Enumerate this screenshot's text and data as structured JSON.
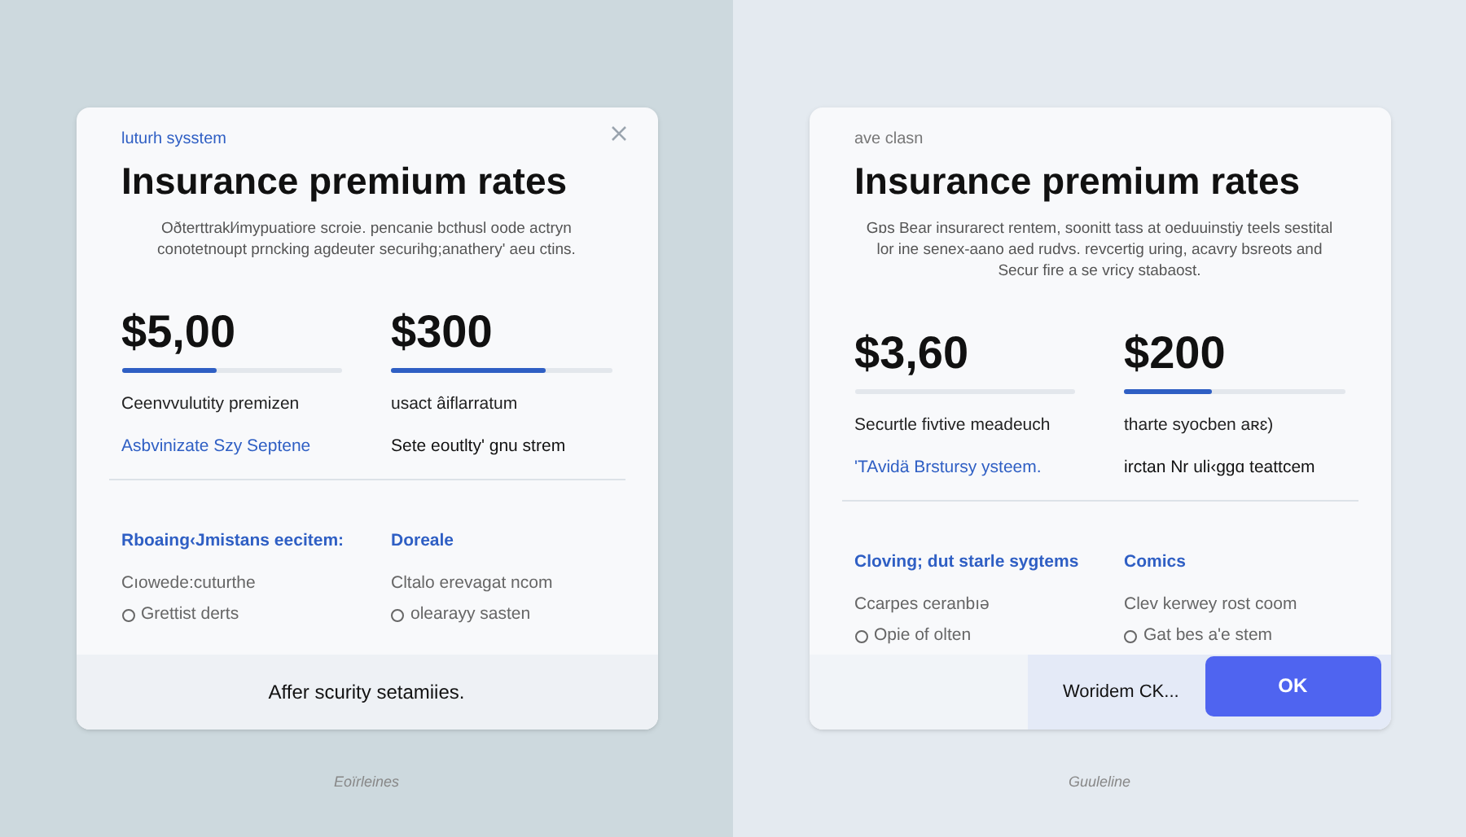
{
  "panels": [
    {
      "eyebrow": "luturh sysstem",
      "closable": true,
      "title": "Insurance premium rates",
      "description": "Oðterttrakl⁄imypuatiore scroie. pencanie bcthusl oode actryn conotetnoupt prncking agdeuter securihg;anathery' aeu ctins.",
      "prices": [
        {
          "amount": "$5,00",
          "level": 0.43,
          "label": "Ceenvvulutity premizen",
          "note": "Asbvinizate Szy Septene",
          "color": "#2f5fc4"
        },
        {
          "amount": "$300",
          "level": 0.7,
          "label": "usact âiflarratum",
          "note": "Sete eoutlty' gnu strem",
          "color": "#111111"
        }
      ],
      "sections": [
        {
          "heading": "Rboaing‹Jmistans eecitem:",
          "line": "Cıowede:cuturthe",
          "option": {
            "label": "Grettist derts",
            "selected": false
          }
        },
        {
          "heading": "Doreale",
          "line": "Cltalo erevagat ncom",
          "option": {
            "label": "olearayy sasten",
            "selected": false
          }
        }
      ],
      "footer": {
        "kind": "text",
        "text": "Affer scurity setamiies."
      },
      "caption": "Eoïrleines"
    },
    {
      "eyebrow": "ave clasn",
      "closable": false,
      "title": "Insurance premium rates",
      "description": "Gɒs Bear insurarect rentem, soonitt tass at oeduuinstiy teels sestital lor ine senex-aano aed rudvs. revcertig uring, acavry bsreots and Secur fire a se vricy stabaost.",
      "prices": [
        {
          "amount": "$3,60",
          "label": "Securtle fivtive meadeuch",
          "note": "'TAvidä Brstursy ysteem.",
          "color": "#2f5fc4"
        },
        {
          "amount": "$200",
          "level": 0.4,
          "label": "tharte syocben aʀɛ)",
          "note": "irctan Nr uli‹ggɑ teattcem",
          "color": "#111111"
        }
      ],
      "sections": [
        {
          "heading": "Cloving; dut starle sygtems",
          "line": "Ccarpes ceranbıə",
          "option": {
            "label": "Opie of olten",
            "selected": false
          }
        },
        {
          "heading": "Comics",
          "line": "Clev kerwey rost coom",
          "option": {
            "label": "Gat bes a'e stem",
            "selected": false
          }
        }
      ],
      "footer": {
        "kind": "actions",
        "text": "Woridem CK...",
        "button": "OK"
      },
      "caption": "Guuleline"
    }
  ]
}
